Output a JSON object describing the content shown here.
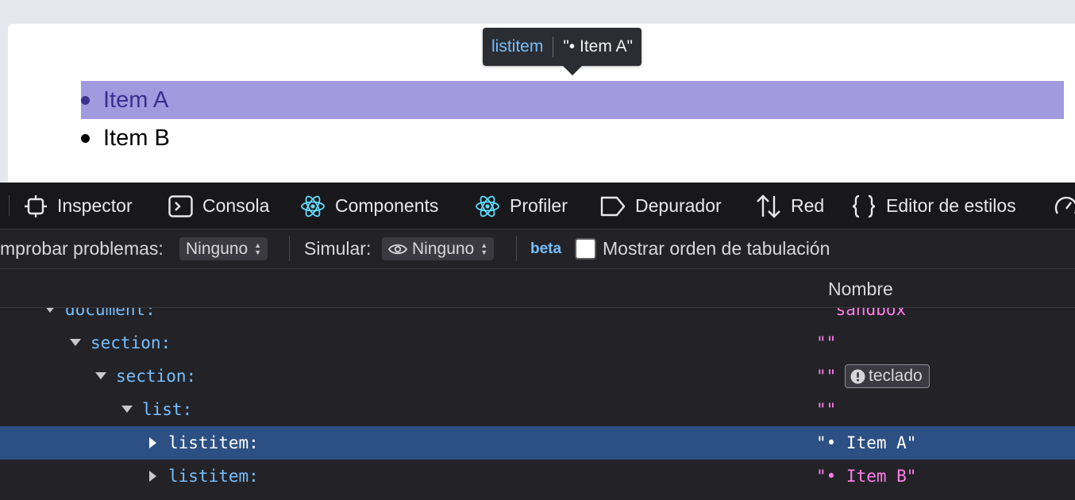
{
  "preview": {
    "items": [
      {
        "label": "Item A",
        "highlighted": true
      },
      {
        "label": "Item B",
        "highlighted": false
      }
    ],
    "tooltip": {
      "role": "listitem",
      "name": "\"• Item A\""
    }
  },
  "devtools": {
    "tabs": [
      {
        "label": "Inspector",
        "icon": "inspector-icon"
      },
      {
        "label": "Consola",
        "icon": "console-icon"
      },
      {
        "label": "Components",
        "icon": "react-icon"
      },
      {
        "label": "Profiler",
        "icon": "react-icon"
      },
      {
        "label": "Depurador",
        "icon": "debugger-icon"
      },
      {
        "label": "Red",
        "icon": "network-arrows-icon"
      },
      {
        "label": "Editor de estilos",
        "icon": "braces-icon"
      }
    ],
    "toolbar": {
      "check_label": "mprobar problemas:",
      "check_value": "Ninguno",
      "simulate_label": "Simular:",
      "simulate_value": "Ninguno",
      "beta": "beta",
      "tab_order_label": "Mostrar orden de tabulación"
    },
    "column_header": "Nombre",
    "tree": [
      {
        "role": "document:",
        "name": "\"sandbox\"",
        "twisty": "open"
      },
      {
        "role": "section:",
        "name": "\"\"",
        "twisty": "open"
      },
      {
        "role": "section:",
        "name": "\"\"",
        "twisty": "open",
        "badge": "teclado"
      },
      {
        "role": "list:",
        "name": "\"\"",
        "twisty": "open"
      },
      {
        "role": "listitem:",
        "name": "\"• Item A\"",
        "twisty": "closed",
        "selected": true
      },
      {
        "role": "listitem:",
        "name": "\"• Item B\"",
        "twisty": "closed"
      }
    ],
    "colors": {
      "role": "#75bfff",
      "name": "#ff7de9",
      "selected_row": "#2c4f84",
      "highlight": "#a29ade"
    }
  }
}
